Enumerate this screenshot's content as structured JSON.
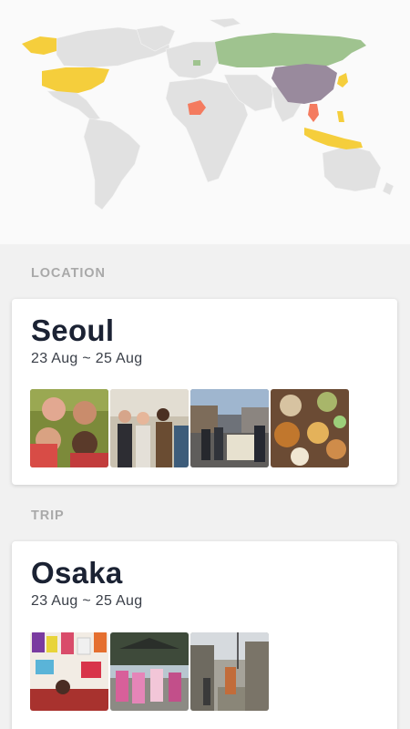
{
  "sections": [
    {
      "label": "LOCATION",
      "card": {
        "title": "Seoul",
        "dates": "23 Aug ~ 25 Aug",
        "photos": [
          "group-selfie-photo",
          "friends-street-photo",
          "street-map-photo",
          "food-table-photo"
        ]
      }
    },
    {
      "label": "TRIP",
      "card": {
        "title": "Osaka",
        "dates": "23 Aug ~ 25 Aug",
        "photos": [
          "colorful-shop-photo",
          "kimono-group-photo",
          "alley-street-photo"
        ]
      }
    }
  ],
  "map": {
    "land_color": "#e1e1e1",
    "highlights": [
      {
        "region": "Alaska",
        "color": "#f5ce3c"
      },
      {
        "region": "United States",
        "color": "#f5ce3c"
      },
      {
        "region": "Russia",
        "color": "#9fc38f"
      },
      {
        "region": "China",
        "color": "#998a9d"
      },
      {
        "region": "Niger",
        "color": "#f47b5f"
      },
      {
        "region": "Japan",
        "color": "#f5ce3c"
      },
      {
        "region": "Thailand",
        "color": "#f47b5f"
      },
      {
        "region": "Indonesia",
        "color": "#f5ce3c"
      }
    ]
  }
}
